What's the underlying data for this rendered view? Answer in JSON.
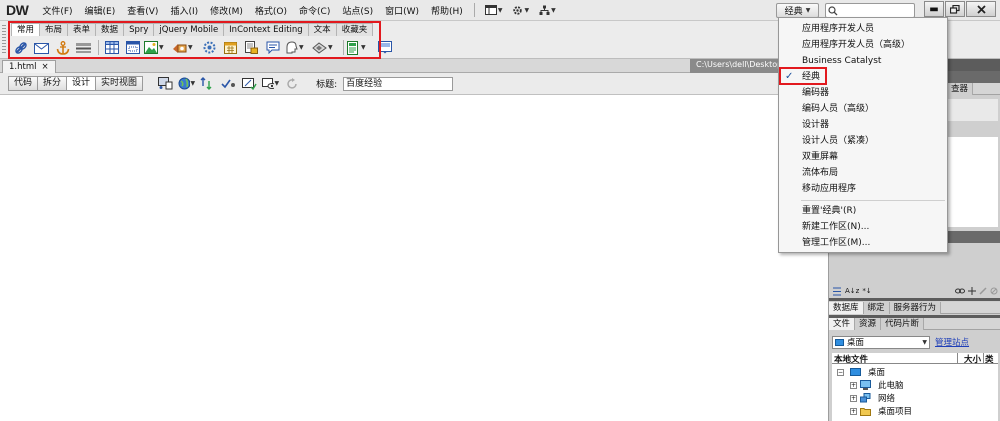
{
  "app": {
    "logo": "DW",
    "menu": [
      "文件(F)",
      "编辑(E)",
      "查看(V)",
      "插入(I)",
      "修改(M)",
      "格式(O)",
      "命令(C)",
      "站点(S)",
      "窗口(W)",
      "帮助(H)"
    ],
    "workspace": "经典"
  },
  "insert_bar": {
    "tabs": [
      "常用",
      "布局",
      "表单",
      "数据",
      "Spry",
      "jQuery Mobile",
      "InContext Editing",
      "文本",
      "收藏夹"
    ],
    "active_tab": "常用"
  },
  "document": {
    "tab": "1.html",
    "close": "×",
    "path": "C:\\Users\\dell\\Desktop",
    "views": [
      "代码",
      "拆分",
      "设计",
      "实时视图"
    ],
    "active_view": "设计",
    "title_label": "标题:",
    "title_value": "百度经验"
  },
  "right_panel": {
    "tabs_top": [
      "数据库",
      "绑定",
      "服务器行为"
    ],
    "tabs_files": [
      "文件",
      "资源",
      "代码片断"
    ],
    "site_select": "桌面",
    "manage_site": "管理站点",
    "cols": [
      "本地文件",
      "大小",
      "类"
    ],
    "tree": [
      {
        "label": "桌面",
        "level": 0
      },
      {
        "label": "此电脑",
        "level": 1
      },
      {
        "label": "网络",
        "level": 1
      },
      {
        "label": "桌面项目",
        "level": 1
      }
    ],
    "inspector_tab": "查器"
  },
  "dropdown": {
    "items": [
      {
        "label": "应用程序开发人员",
        "checked": false
      },
      {
        "label": "应用程序开发人员（高级）",
        "checked": false
      },
      {
        "label": "Business Catalyst",
        "checked": false
      },
      {
        "label": "经典",
        "checked": true
      },
      {
        "label": "编码器",
        "checked": false
      },
      {
        "label": "编码人员（高级）",
        "checked": false
      },
      {
        "label": "设计器",
        "checked": false
      },
      {
        "label": "设计人员（紧凑）",
        "checked": false
      },
      {
        "label": "双重屏幕",
        "checked": false
      },
      {
        "label": "流体布局",
        "checked": false
      },
      {
        "label": "移动应用程序",
        "checked": false
      }
    ],
    "actions": [
      "重置'经典'(R)",
      "新建工作区(N)...",
      "管理工作区(M)..."
    ],
    "check_mark": "✓"
  },
  "colors": {
    "highlight_red": "#e2191e",
    "panel_dark": "#5c5c5c",
    "link_blue": "#1f3fb8"
  }
}
